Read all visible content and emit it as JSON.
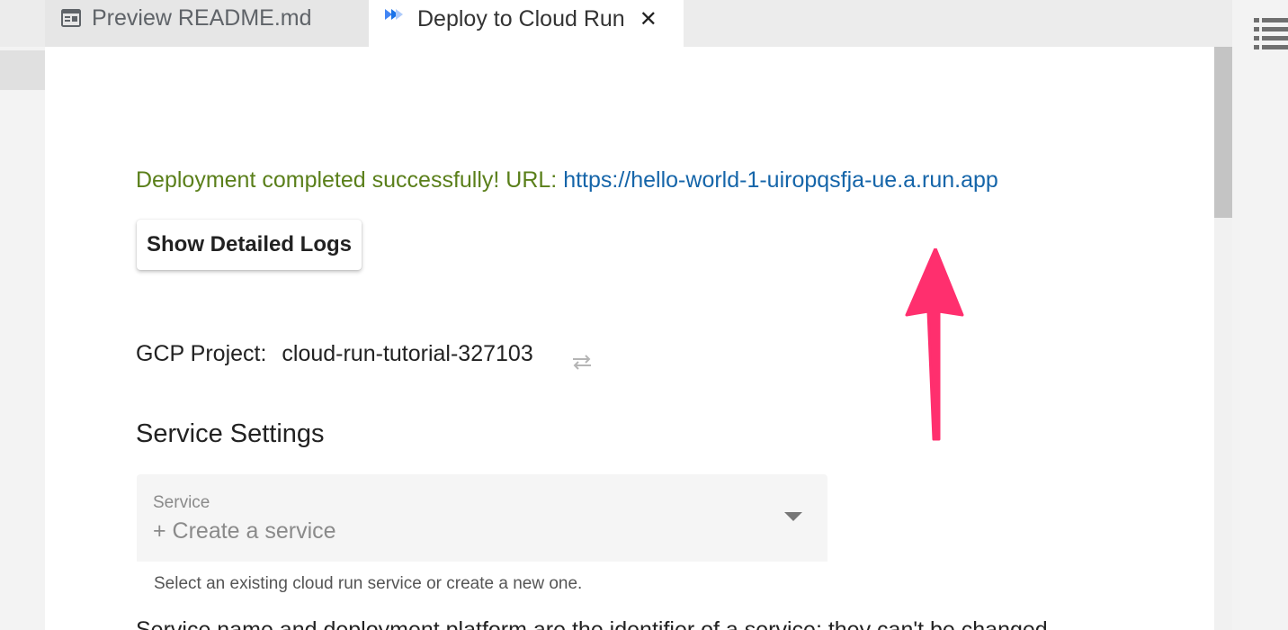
{
  "tabs": [
    {
      "label": "Preview README.md",
      "icon": "preview-icon",
      "active": false
    },
    {
      "label": "Deploy to Cloud Run",
      "icon": "cloud-run-icon",
      "active": true,
      "close": "✕"
    }
  ],
  "status": {
    "message": "Deployment completed successfully! URL:",
    "url": "https://hello-world-1-uiropqsfja-ue.a.run.app"
  },
  "buttons": {
    "logs": "Show Detailed Logs"
  },
  "project": {
    "label": "GCP Project:",
    "value": "cloud-run-tutorial-327103"
  },
  "service_settings": {
    "title": "Service Settings",
    "service_label": "Service",
    "service_value": "+ Create a service",
    "helper": "Select an existing cloud run service or create a new one.",
    "cutoff_text": "Service name and deployment platform are the identifier of a service; they can't be changed."
  },
  "colors": {
    "success": "#5a7f1a",
    "link": "#1565a9",
    "arrow": "#ff2f6e",
    "cloud_run_dark": "#1a73e8",
    "cloud_run_light": "#4285f4"
  },
  "icons": {
    "swap": "swap-arrows-icon",
    "menu": "list-menu-icon",
    "annotation": "arrow-up-annotation"
  }
}
